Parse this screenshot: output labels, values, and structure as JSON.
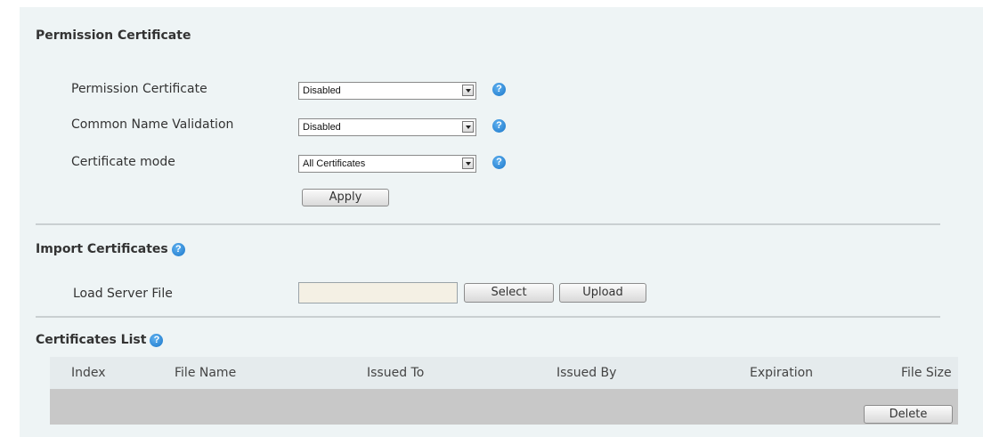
{
  "permission_section": {
    "title": "Permission Certificate",
    "fields": [
      {
        "label": "Permission Certificate",
        "value": "Disabled"
      },
      {
        "label": "Common Name Validation",
        "value": "Disabled"
      },
      {
        "label": "Certificate mode",
        "value": "All Certificates"
      }
    ],
    "apply_label": "Apply"
  },
  "import_section": {
    "title": "Import Certificates",
    "load_label": "Load Server File",
    "file_value": "",
    "select_label": "Select",
    "upload_label": "Upload"
  },
  "list_section": {
    "title": "Certificates List",
    "columns": [
      "Index",
      "File Name",
      "Issued To",
      "Issued By",
      "Expiration",
      "File Size"
    ],
    "delete_label": "Delete"
  },
  "help_glyph": "?",
  "colors": {
    "panel_bg": "#eef4f5",
    "help_blue": "#1a76c9",
    "table_body": "#c8c8c8"
  }
}
